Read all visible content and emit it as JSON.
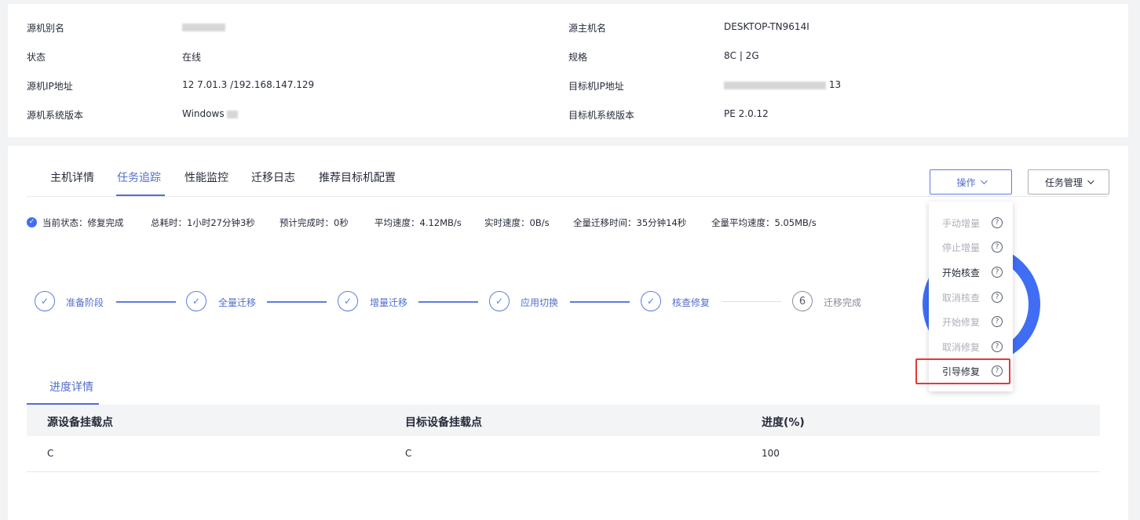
{
  "info": {
    "rows": [
      {
        "label": "源机别名",
        "value": "",
        "label2": "源主机名",
        "value2": "DESKTOP-TN9614I"
      },
      {
        "label": "状态",
        "value": "在线",
        "label2": "规格",
        "value2": "8C | 2G"
      },
      {
        "label": "源机IP地址",
        "value": "12   7.01.3 /192.168.147.129",
        "label2": "目标机IP地址",
        "value2": "13"
      },
      {
        "label": "源机系统版本",
        "value": "Windows",
        "label2": "目标机系统版本",
        "value2": "PE 2.0.12"
      }
    ]
  },
  "tabs": [
    "主机详情",
    "任务追踪",
    "性能监控",
    "迁移日志",
    "推荐目标机配置"
  ],
  "buttons": {
    "operate": "操作",
    "task_manage": "任务管理"
  },
  "status": {
    "current": "当前状态：修复完成",
    "total_time": "总耗时：1小时27分钟3秒",
    "eta": "预计完成时：0秒",
    "avg_speed": "平均速度：4.12MB/s",
    "realtime_speed": "实时速度：0B/s",
    "full_time": "全量迁移时间：35分钟14秒",
    "full_avg_speed": "全量平均速度：5.05MB/s"
  },
  "steps": [
    {
      "label": "准备阶段",
      "done": true
    },
    {
      "label": "全量迁移",
      "done": true
    },
    {
      "label": "增量迁移",
      "done": true
    },
    {
      "label": "应用切换",
      "done": true
    },
    {
      "label": "核查修复",
      "done": true
    },
    {
      "label": "迁移完成",
      "done": false,
      "number": "6"
    }
  ],
  "subtab": "进度详情",
  "table": {
    "headers": [
      "源设备挂载点",
      "目标设备挂载点",
      "进度(%)"
    ],
    "rows": [
      [
        "C",
        "C",
        "100"
      ]
    ]
  },
  "dropdown": [
    {
      "label": "手动增量",
      "enabled": false
    },
    {
      "label": "停止增量",
      "enabled": false
    },
    {
      "label": "开始核查",
      "enabled": true
    },
    {
      "label": "取消核查",
      "enabled": false
    },
    {
      "label": "开始修复",
      "enabled": false
    },
    {
      "label": "取消修复",
      "enabled": false
    },
    {
      "label": "引导修复",
      "enabled": true
    }
  ],
  "help_icon": "?",
  "check_icon": "✓",
  "colors": {
    "accent": "#526ecc",
    "highlight": "#e53935"
  }
}
